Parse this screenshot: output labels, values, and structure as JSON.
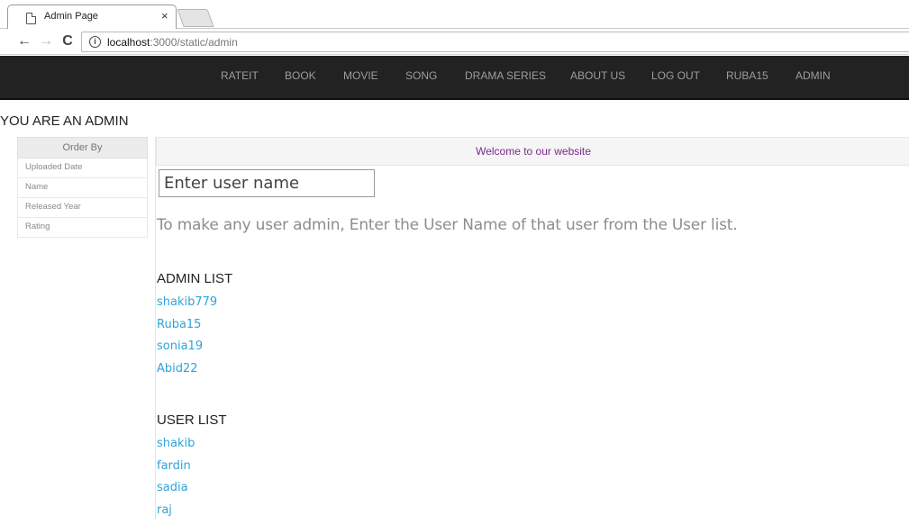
{
  "browser": {
    "tab_title": "Admin Page",
    "tab_close": "×",
    "back_icon": "←",
    "forward_icon": "→",
    "reload_icon": "C",
    "info_icon": "i",
    "url_host": "localhost",
    "url_rest": ":3000/static/admin"
  },
  "navbar": {
    "items": [
      "RATEIT",
      "BOOK",
      "MOVIE",
      "SONG",
      "DRAMA SERIES",
      "ABOUT US",
      "LOG OUT",
      "RUBA15",
      "ADMIN"
    ]
  },
  "page": {
    "heading": "YOU ARE AN ADMIN",
    "welcome": "Welcome to our website",
    "input_placeholder": "Enter user name",
    "instruction": "To make any user admin, Enter the User Name of that user from the User list."
  },
  "orderby": {
    "title": "Order By",
    "items": [
      "Uploaded Date",
      "Name",
      "Released Year",
      "Rating"
    ]
  },
  "admin_list": {
    "title": "ADMIN LIST",
    "users": [
      "shakib779",
      "Ruba15",
      "sonia19",
      "Abid22"
    ]
  },
  "user_list": {
    "title": "USER LIST",
    "users": [
      "shakib",
      "fardin",
      "sadia",
      "raj"
    ]
  },
  "colors": {
    "navbar_bg": "#222222",
    "nav_text": "#9d9d9d",
    "link": "#2fa4d8",
    "welcome_text": "#7a2a8a"
  }
}
